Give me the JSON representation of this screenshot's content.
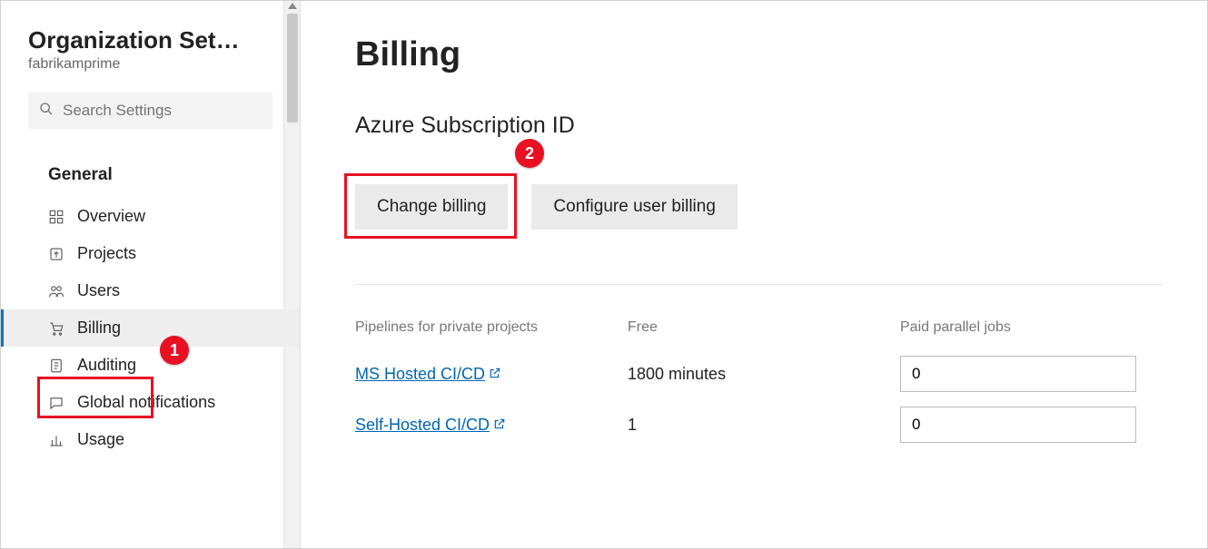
{
  "sidebar": {
    "title": "Organization Settin…",
    "subtitle": "fabrikamprime",
    "search_placeholder": "Search Settings",
    "section_label": "General",
    "items": [
      {
        "label": "Overview"
      },
      {
        "label": "Projects"
      },
      {
        "label": "Users"
      },
      {
        "label": "Billing"
      },
      {
        "label": "Auditing"
      },
      {
        "label": "Global notifications"
      },
      {
        "label": "Usage"
      }
    ]
  },
  "callouts": {
    "one": "1",
    "two": "2"
  },
  "main": {
    "title": "Billing",
    "subscription_heading": "Azure Subscription ID",
    "change_billing_label": "Change billing",
    "configure_user_billing_label": "Configure user billing",
    "table": {
      "col1": "Pipelines for private projects",
      "col2": "Free",
      "col3": "Paid parallel jobs",
      "rows": [
        {
          "name": "MS Hosted CI/CD",
          "free": "1800 minutes",
          "paid": "0"
        },
        {
          "name": "Self-Hosted CI/CD",
          "free": "1",
          "paid": "0"
        }
      ]
    }
  }
}
